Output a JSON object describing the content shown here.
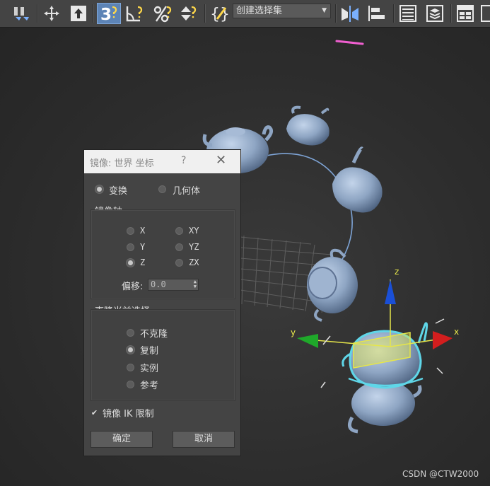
{
  "toolbar": {
    "selection_set_dropdown": {
      "label": "创建选择集"
    },
    "snap_button_label": "3"
  },
  "dialog": {
    "title": "镜像: 世界 坐标",
    "help": "?",
    "close": "✕",
    "mode": {
      "options": [
        {
          "label": "变换",
          "selected": true
        },
        {
          "label": "几何体",
          "selected": false
        }
      ]
    },
    "mirror_axis": {
      "label": "镜像轴:",
      "axes": [
        {
          "label": "X",
          "selected": false
        },
        {
          "label": "Y",
          "selected": false
        },
        {
          "label": "Z",
          "selected": true
        },
        {
          "label": "XY",
          "selected": false
        },
        {
          "label": "YZ",
          "selected": false
        },
        {
          "label": "ZX",
          "selected": false
        }
      ],
      "offset_label": "偏移:",
      "offset_value": "0.0"
    },
    "clone": {
      "label": "克隆当前选择:",
      "options": [
        {
          "label": "不克隆",
          "selected": false
        },
        {
          "label": "复制",
          "selected": true
        },
        {
          "label": "实例",
          "selected": false
        },
        {
          "label": "参考",
          "selected": false
        }
      ]
    },
    "mirror_ik": {
      "label": "镜像 IK 限制",
      "checked": true
    },
    "ok_label": "确定",
    "cancel_label": "取消"
  },
  "viewport": {
    "gizmo_labels": {
      "z": "z",
      "y": "y",
      "x": "x"
    }
  },
  "watermark": "CSDN @CTW2000",
  "colors": {
    "toolbar_bg": "#444444",
    "dialog_bg": "#444444",
    "accent_active": "#5d84b6",
    "teapot": "#8fa6c4",
    "selection_cyan": "#5fd6e8",
    "gizmo_yellow": "#e6e64a"
  }
}
